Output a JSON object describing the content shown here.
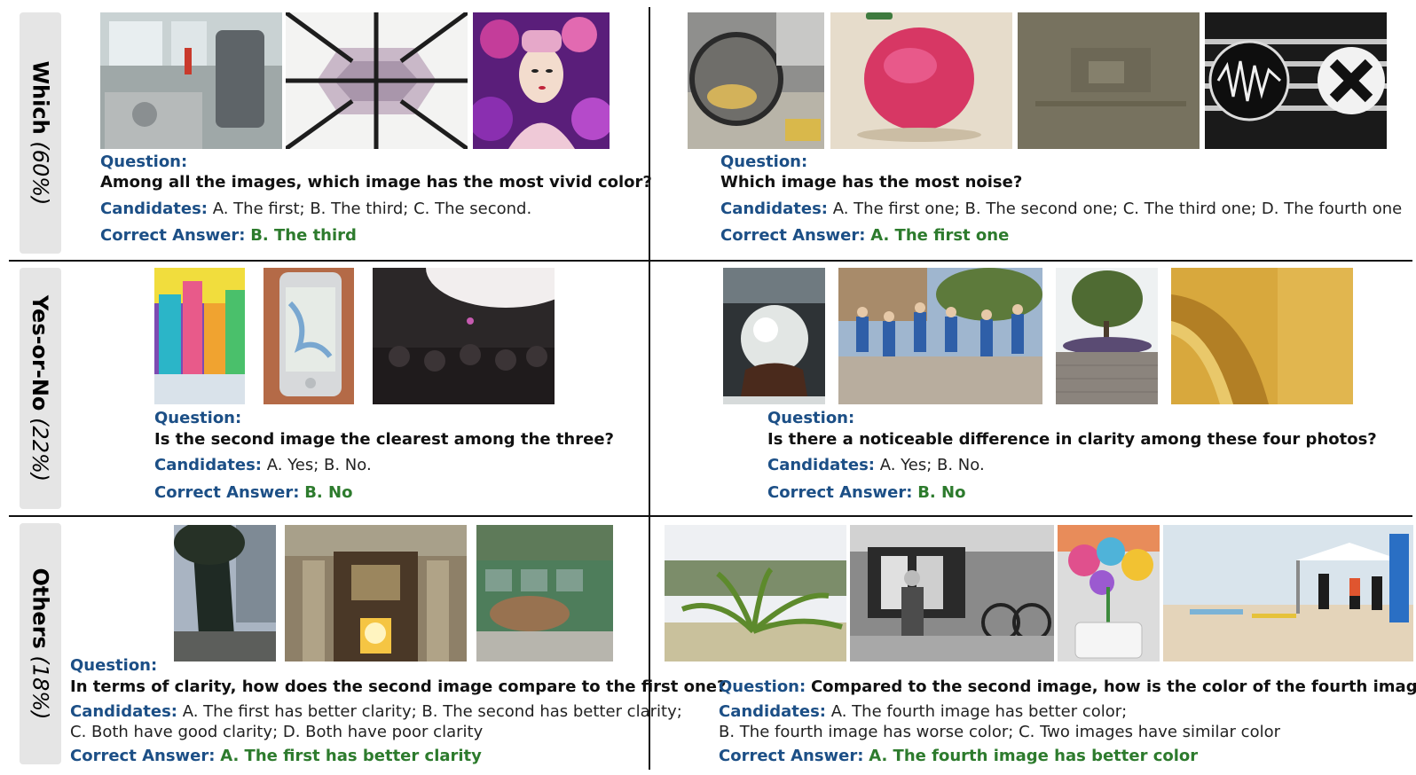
{
  "categories": {
    "which": {
      "name": "Which",
      "pct": "(60%)"
    },
    "yesno": {
      "name": "Yes-or-No",
      "pct": "(22%)"
    },
    "others": {
      "name": "Others",
      "pct": "(18%)"
    }
  },
  "labels": {
    "question": "Question:",
    "candidates": "Candidates:",
    "answer": "Correct Answer:"
  },
  "panels": {
    "which_left": {
      "question": "Among all the images, which image has the most vivid color?",
      "candidates": "A. The first; B. The third; C. The second.",
      "answer": "B. The third"
    },
    "which_right": {
      "question": "Which image has the most noise?",
      "candidates": "A. The first one; B. The second one; C. The third one; D. The fourth one",
      "answer": "A. The first one"
    },
    "yesno_left": {
      "question": "Is the second image the clearest among the three?",
      "candidates": "A. Yes; B. No.",
      "answer": "B. No"
    },
    "yesno_right": {
      "question": "Is there a noticeable difference in clarity among these four photos?",
      "candidates": "A. Yes; B. No.",
      "answer": "B. No"
    },
    "others_left": {
      "question": "In terms of clarity, how does the second image compare to the first one?",
      "candidates_1": "A. The first has better clarity; B. The second has better clarity;",
      "candidates_2": "C. Both have good clarity; D. Both have poor clarity",
      "answer": "A. The first has better clarity"
    },
    "others_right": {
      "question": "Compared to the second image, how is the color of the fourth image?",
      "candidates_1": "A. The fourth image has better color;",
      "candidates_2": "B. The fourth image has worse color; C. Two images have similar color",
      "answer": "A. The fourth image has better color"
    }
  }
}
